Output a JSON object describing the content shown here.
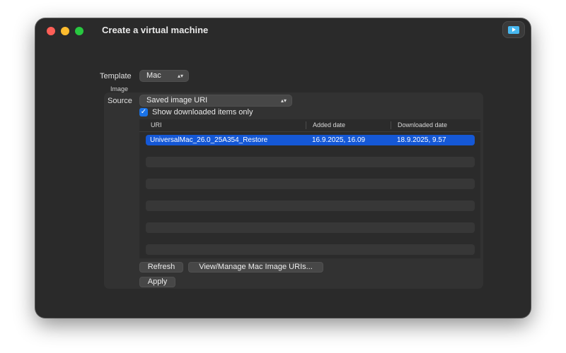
{
  "window": {
    "title": "Create a virtual machine",
    "toolbar_icon": "play-video-icon",
    "accent_color": "#1558d6"
  },
  "form": {
    "template_label": "Template",
    "template_value": "Mac",
    "image_label": "Image",
    "source_label": "Source",
    "source_value": "Saved image URI",
    "show_downloaded_label": "Show downloaded items only",
    "show_downloaded_checked": true
  },
  "table": {
    "columns": [
      "URI",
      "Added date",
      "Downloaded date"
    ],
    "rows": [
      {
        "uri": "UniversalMac_26.0_25A354_Restore",
        "added": "16.9.2025, 16.09",
        "downloaded": "18.9.2025, 9.57",
        "selected": true
      }
    ]
  },
  "buttons": {
    "refresh": "Refresh",
    "manage": "View/Manage Mac Image URIs...",
    "apply": "Apply"
  }
}
